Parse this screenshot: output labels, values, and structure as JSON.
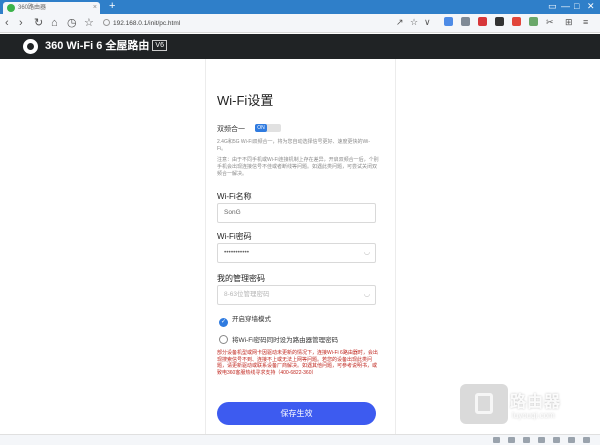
{
  "browser": {
    "tab_title": "360路由器",
    "tab_close": "×",
    "new_tab": "+",
    "url": "192.168.0.1/init/pc.html",
    "window_controls": [
      "▭",
      "—",
      "□",
      "✕"
    ]
  },
  "header": {
    "brand": "360 Wi-Fi 6 全屋路由",
    "badge": "V6"
  },
  "page": {
    "title": "Wi-Fi设置",
    "dual_band": {
      "label": "双频合一",
      "toggle_text": "ON",
      "description": "2.4G和5G Wi-Fi双频合一，将为您自动选择信号更好、速度更快的Wi-Fi。"
    },
    "note": "注意：由于不同手机或Wi-Fi连接机制上存在差异，开启双频合一后，个别手机会出现连接信号不佳或者断线等问题。如遇此类问题，可尝试关闭双频合一解决。",
    "wifi_name": {
      "label": "Wi-Fi名称",
      "value": "SonG"
    },
    "wifi_password": {
      "label": "Wi-Fi密码",
      "value": "•••••••••••"
    },
    "admin_password": {
      "label": "我的管理密码",
      "placeholder": "8-63位管理密码"
    },
    "options": [
      {
        "label": "开启穿墙模式",
        "checked": true
      },
      {
        "label": "将Wi-Fi密码同时设为路由器管理密码",
        "checked": false
      }
    ],
    "warning": "部分设备机型或网卡因驱动未更新的情况下，连接Wi-Fi 6路由器时，会出现搜索信号不到、连接不上或无法上网等问题。若您的设备出现此类问题，请更新驱动或联系设备厂商解决。如遇其他问题，可参考说明书，或致电360客服热线寻求支持（400-6822-360）",
    "save_button": "保存生效"
  },
  "watermark": {
    "title": "路由器",
    "domain": "luyouqi.com"
  },
  "colors": {
    "tab_strip": "#2f7fc9",
    "header_bg": "#202325",
    "accent": "#2f7be0",
    "button": "#3d5bf0",
    "warning": "#c0271f"
  }
}
